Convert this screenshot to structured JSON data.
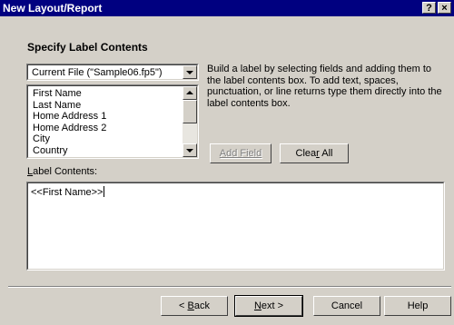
{
  "window": {
    "title": "New Layout/Report",
    "help_glyph": "?",
    "close_glyph": "×"
  },
  "heading": "Specify Label Contents",
  "source": {
    "selected": "Current File (\"Sample06.fp5\")"
  },
  "fields": [
    "First Name",
    "Last Name",
    "Home Address 1",
    "Home Address 2",
    "City",
    "Country"
  ],
  "instructions": "Build a label by selecting fields and adding them to the label contents box. To add text, spaces, punctuation, or line returns type them directly into the label contents box.",
  "buttons": {
    "add_field": "Add Field",
    "clear_all_pre": "Clea",
    "clear_all_u": "r",
    "clear_all_post": " All",
    "back_pre": "< ",
    "back_u": "B",
    "back_post": "ack",
    "next_u": "N",
    "next_post": "ext >",
    "cancel": "Cancel",
    "help": "Help"
  },
  "label_contents": {
    "caption_u": "L",
    "caption_post": "abel Contents:",
    "value": "<<First Name>>"
  },
  "icons": {
    "help": "help-icon",
    "close": "close-icon",
    "dropdown": "chevron-down-icon",
    "scroll_up": "arrow-up-icon",
    "scroll_down": "arrow-down-icon"
  }
}
